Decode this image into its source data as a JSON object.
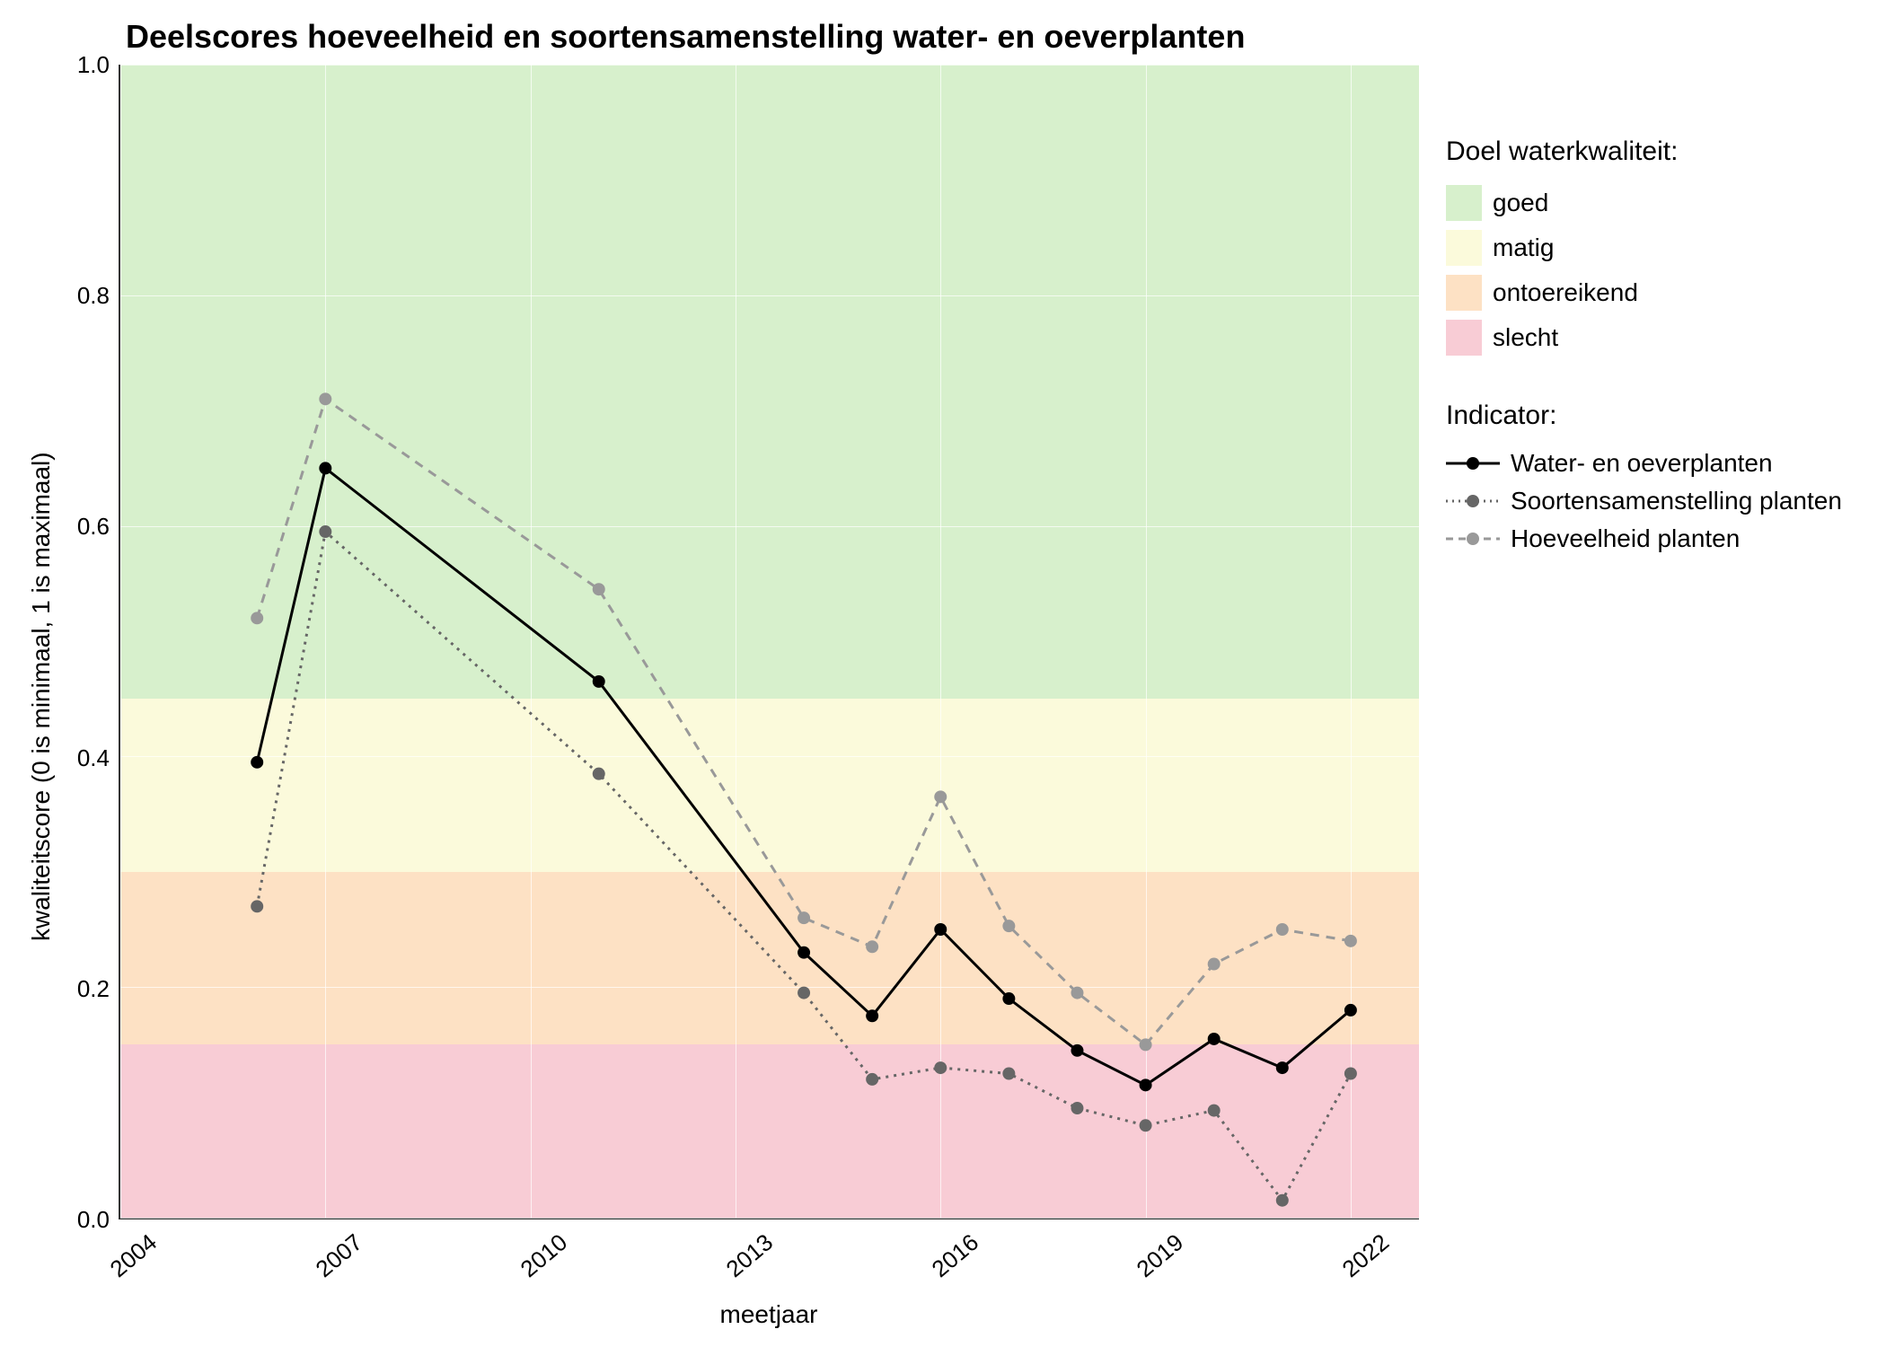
{
  "chart_data": {
    "type": "line",
    "title": "Deelscores hoeveelheid en soortensamenstelling water- en oeverplanten",
    "xlabel": "meetjaar",
    "ylabel": "kwaliteitscore (0 is minimaal, 1 is maximaal)",
    "xlim": [
      2004,
      2023
    ],
    "ylim": [
      0.0,
      1.0
    ],
    "x_ticks": [
      2004,
      2007,
      2010,
      2013,
      2016,
      2019,
      2022
    ],
    "y_ticks": [
      0.0,
      0.2,
      0.4,
      0.6,
      0.8,
      1.0
    ],
    "series": [
      {
        "name": "Water- en oeverplanten",
        "style": "solid",
        "color": "#000000",
        "x": [
          2006,
          2007,
          2011,
          2014,
          2015,
          2016,
          2017,
          2018,
          2019,
          2020,
          2021,
          2022
        ],
        "values": [
          0.395,
          0.65,
          0.465,
          0.23,
          0.175,
          0.25,
          0.19,
          0.145,
          0.115,
          0.155,
          0.13,
          0.18
        ]
      },
      {
        "name": "Soortensamenstelling planten",
        "style": "dotted",
        "color": "#666666",
        "x": [
          2006,
          2007,
          2011,
          2014,
          2015,
          2016,
          2017,
          2018,
          2019,
          2020,
          2021,
          2022
        ],
        "values": [
          0.27,
          0.595,
          0.385,
          0.195,
          0.12,
          0.13,
          0.125,
          0.095,
          0.08,
          0.093,
          0.015,
          0.125
        ]
      },
      {
        "name": "Hoeveelheid planten",
        "style": "dashed",
        "color": "#999999",
        "x": [
          2006,
          2007,
          2011,
          2014,
          2015,
          2016,
          2017,
          2018,
          2019,
          2020,
          2021,
          2022
        ],
        "values": [
          0.52,
          0.71,
          0.545,
          0.26,
          0.235,
          0.365,
          0.253,
          0.195,
          0.15,
          0.22,
          0.25,
          0.24
        ]
      }
    ],
    "background_bands": [
      {
        "label": "goed",
        "color": "#d7f0cc",
        "ymin": 0.45,
        "ymax": 1.0
      },
      {
        "label": "matig",
        "color": "#fbfadb",
        "ymin": 0.3,
        "ymax": 0.45
      },
      {
        "label": "ontoereikend",
        "color": "#fde1c4",
        "ymin": 0.15,
        "ymax": 0.3
      },
      {
        "label": "slecht",
        "color": "#f8ccd5",
        "ymin": 0.0,
        "ymax": 0.15
      }
    ],
    "legend_titles": {
      "bands": "Doel waterkwaliteit:",
      "series": "Indicator:"
    }
  }
}
